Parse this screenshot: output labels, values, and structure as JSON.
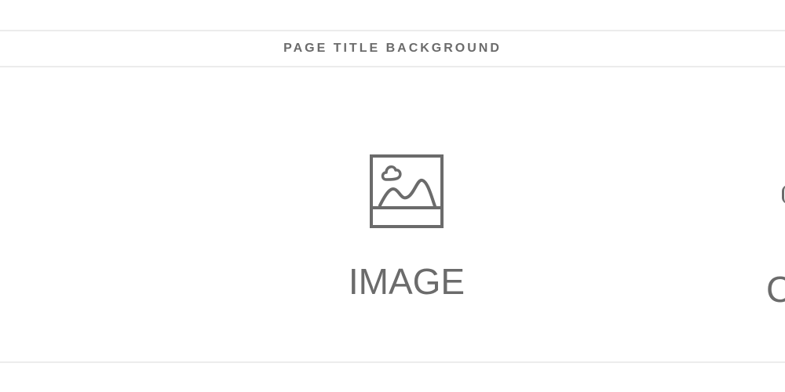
{
  "page_title": "PAGE TITLE BACKGROUND",
  "cards": [
    {
      "label": "IMAGE",
      "icon": "image-icon"
    },
    {
      "label": "C",
      "icon": "partial-icon"
    }
  ],
  "colors": {
    "text": "#6b6b6b",
    "rule": "#ececec",
    "background": "#ffffff"
  }
}
